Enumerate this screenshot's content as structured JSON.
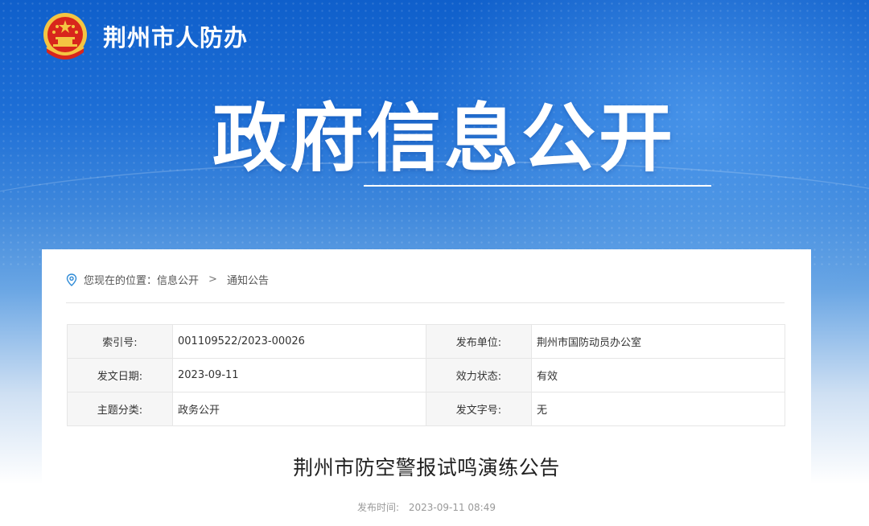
{
  "header": {
    "site_name": "荆州市人防办",
    "hero_title": "政府信息公开"
  },
  "breadcrumb": {
    "prefix": "您现在的位置：",
    "items": [
      "信息公开",
      "通知公告"
    ],
    "separator": ">"
  },
  "meta": {
    "rows": [
      [
        {
          "label": "索引号:",
          "value": "001109522/2023-00026"
        },
        {
          "label": "发布单位:",
          "value": "荆州市国防动员办公室"
        }
      ],
      [
        {
          "label": "发文日期:",
          "value": "2023-09-11"
        },
        {
          "label": "效力状态:",
          "value": "有效"
        }
      ],
      [
        {
          "label": "主题分类:",
          "value": "政务公开"
        },
        {
          "label": "发文字号:",
          "value": "无"
        }
      ]
    ]
  },
  "article": {
    "title": "荆州市防空警报试鸣演练公告",
    "pub_label": "发布时间:",
    "pub_time": "2023-09-11 08:49"
  },
  "colors": {
    "banner_top": "#0f5fcb",
    "accent": "#1e6fd6",
    "emblem_red": "#d8261c",
    "emblem_gold": "#f4c542"
  }
}
